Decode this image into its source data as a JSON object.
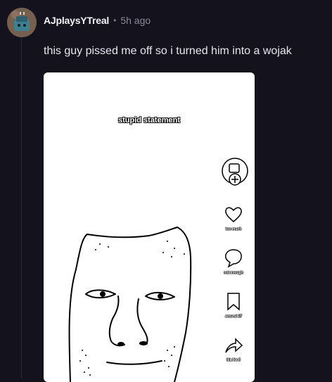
{
  "post": {
    "username": "AJplaysYTreal",
    "separator": "•",
    "time": "5h ago",
    "text": "this guy pissed me off so i turned him into a wojak"
  },
  "image": {
    "caption": "stupid statement",
    "side_buttons": [
      {
        "icon": "heart-icon",
        "label": "too much"
      },
      {
        "icon": "comment-icon",
        "label": "not enough"
      },
      {
        "icon": "bookmark-icon",
        "label": "around 17"
      },
      {
        "icon": "share-icon",
        "label": "bla lka 8"
      }
    ]
  }
}
